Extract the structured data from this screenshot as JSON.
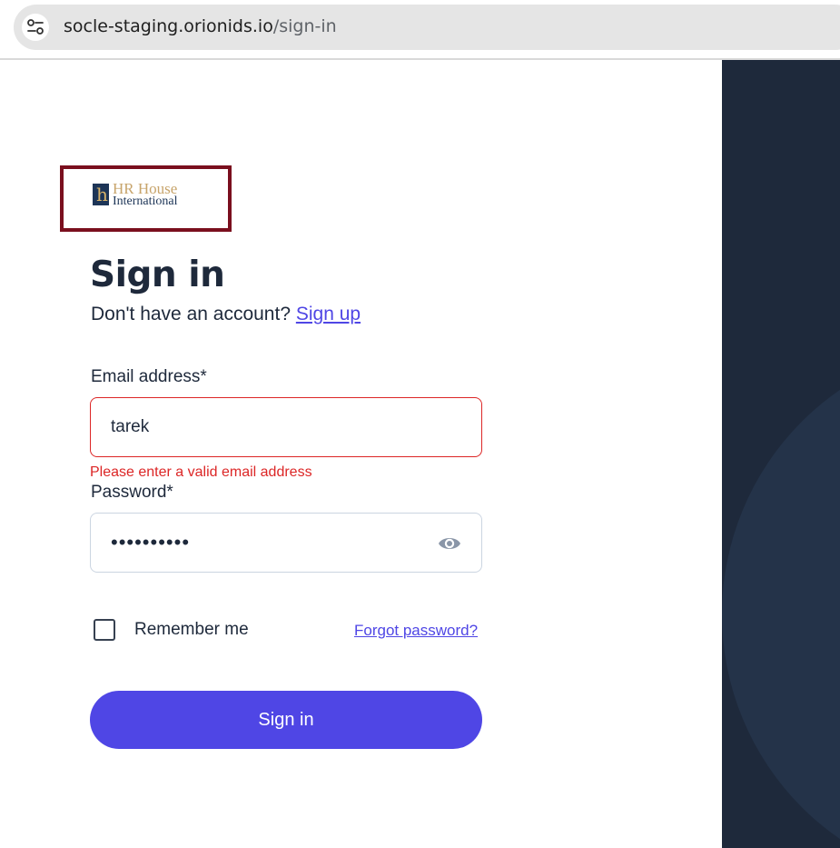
{
  "browser": {
    "url_host": "socle-staging.orionids.io",
    "url_path": "/sign-in",
    "site_info_icon": "tune-icon"
  },
  "logo": {
    "mark": "h",
    "line1": "HR House",
    "line2": "International"
  },
  "signin": {
    "title": "Sign in",
    "no_account_text": "Don't have an account?",
    "signup_link": "Sign up",
    "email_label": "Email address*",
    "email_value": "tarek",
    "email_error": "Please enter a valid email address",
    "password_label": "Password*",
    "password_value": "••••••••••",
    "password_toggle_icon": "eye-icon",
    "remember_label": "Remember me",
    "remember_checked": false,
    "forgot_link": "Forgot password?",
    "submit_label": "Sign in"
  },
  "colors": {
    "primary": "#4f46e5",
    "error": "#dc2626",
    "panel": "#1e293b",
    "logo_border": "#7a0f1e"
  }
}
